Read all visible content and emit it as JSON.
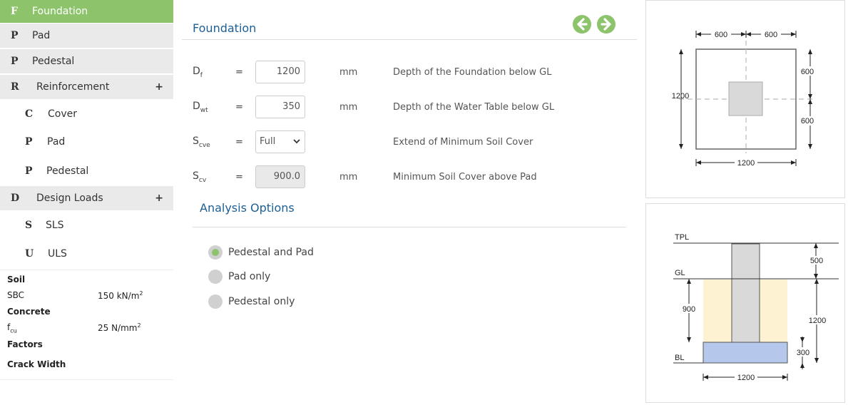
{
  "sidebar": {
    "items": [
      {
        "letter": "F",
        "label": "Foundation"
      },
      {
        "letter": "P",
        "label": "Pad"
      },
      {
        "letter": "P",
        "label": "Pedestal"
      },
      {
        "letter": "R",
        "label": "Reinforcement",
        "expander": "+"
      },
      {
        "letter": "C",
        "label": "Cover"
      },
      {
        "letter": "P",
        "label": "Pad"
      },
      {
        "letter": "P",
        "label": "Pedestal"
      },
      {
        "letter": "D",
        "label": "Design Loads",
        "expander": "+"
      },
      {
        "letter": "S",
        "label": "SLS"
      },
      {
        "letter": "U",
        "label": "ULS"
      }
    ]
  },
  "summary": {
    "soil_heading": "Soil",
    "sbc_label": "SBC",
    "sbc_value": "150 kN/m",
    "sbc_exp": "2",
    "concrete_heading": "Concrete",
    "fcu_label": "f",
    "fcu_sub": "cu",
    "fcu_value": "25 N/mm",
    "fcu_exp": "2",
    "factors_heading": "Factors",
    "crack_heading": "Crack Width"
  },
  "main": {
    "title": "Foundation",
    "nav_prev_icon": "arrow-left-icon",
    "nav_next_icon": "arrow-right-icon",
    "eq": "=",
    "rows": [
      {
        "sym": "D",
        "sub": "f",
        "value": "1200",
        "unit": "mm",
        "desc": "Depth of the Foundation below GL"
      },
      {
        "sym": "D",
        "sub": "wt",
        "value": "350",
        "unit": "mm",
        "desc": "Depth of the Water Table below GL"
      },
      {
        "sym": "S",
        "sub": "cve",
        "value": "Full",
        "unit": "",
        "desc": "Extend of Minimum Soil Cover"
      },
      {
        "sym": "S",
        "sub": "cv",
        "value": "900.0",
        "unit": "mm",
        "desc": "Minimum Soil Cover above Pad"
      }
    ],
    "analysis_title": "Analysis Options",
    "options": [
      {
        "label": "Pedestal and Pad",
        "selected": true
      },
      {
        "label": "Pad only",
        "selected": false
      },
      {
        "label": "Pedestal only",
        "selected": false
      }
    ]
  },
  "plan": {
    "top_left": "600",
    "top_right": "600",
    "left": "1200",
    "right_top": "600",
    "right_bottom": "600",
    "bottom": "1200"
  },
  "section": {
    "tpl": "TPL",
    "gl": "GL",
    "bl": "BL",
    "dim_500": "500",
    "dim_900": "900",
    "dim_1200_v": "1200",
    "dim_300": "300",
    "dim_1200_h": "1200"
  },
  "colors": {
    "accent": "#8dc36b",
    "heading": "#1c5f95",
    "soil": "#fdf3d2",
    "pad": "#b5c7ea",
    "pedestal": "#d9d9d9"
  }
}
